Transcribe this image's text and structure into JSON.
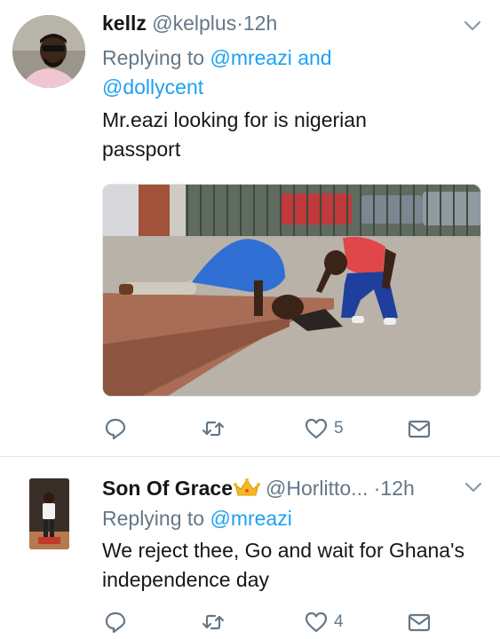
{
  "tweets": [
    {
      "display_name": "kellz",
      "handle": "@kelplus",
      "separator": "·",
      "time": "12h",
      "replying_prefix": "Replying to",
      "mention_1": "@mreazi",
      "mention_joiner": "and",
      "mention_2": "@dollycent",
      "text": "Mr.eazi looking for is nigerian passport",
      "has_media": true,
      "actions": {
        "reply_count": "",
        "retweet_count": "",
        "like_count": "5"
      },
      "icons": [
        "chevron-down-icon",
        "reply-icon",
        "retweet-icon",
        "heart-icon",
        "direct-message-icon"
      ]
    },
    {
      "display_name": "Son Of Grace",
      "handle": "@Horlitto...",
      "separator": "·",
      "time": "12h",
      "replying_prefix": "Replying to",
      "mention_1": "@mreazi",
      "text": "We reject thee, Go and wait for Ghana's independence day",
      "has_media": false,
      "actions": {
        "reply_count": "",
        "retweet_count": "",
        "like_count": "4"
      },
      "icons": [
        "crown-emoji-icon",
        "chevron-down-icon",
        "reply-icon",
        "retweet-icon",
        "heart-icon",
        "direct-message-icon"
      ]
    }
  ],
  "colors": {
    "text_primary": "#14171a",
    "text_secondary": "#657786",
    "link_blue": "#1da1f2",
    "divider": "#e1e8ed"
  }
}
